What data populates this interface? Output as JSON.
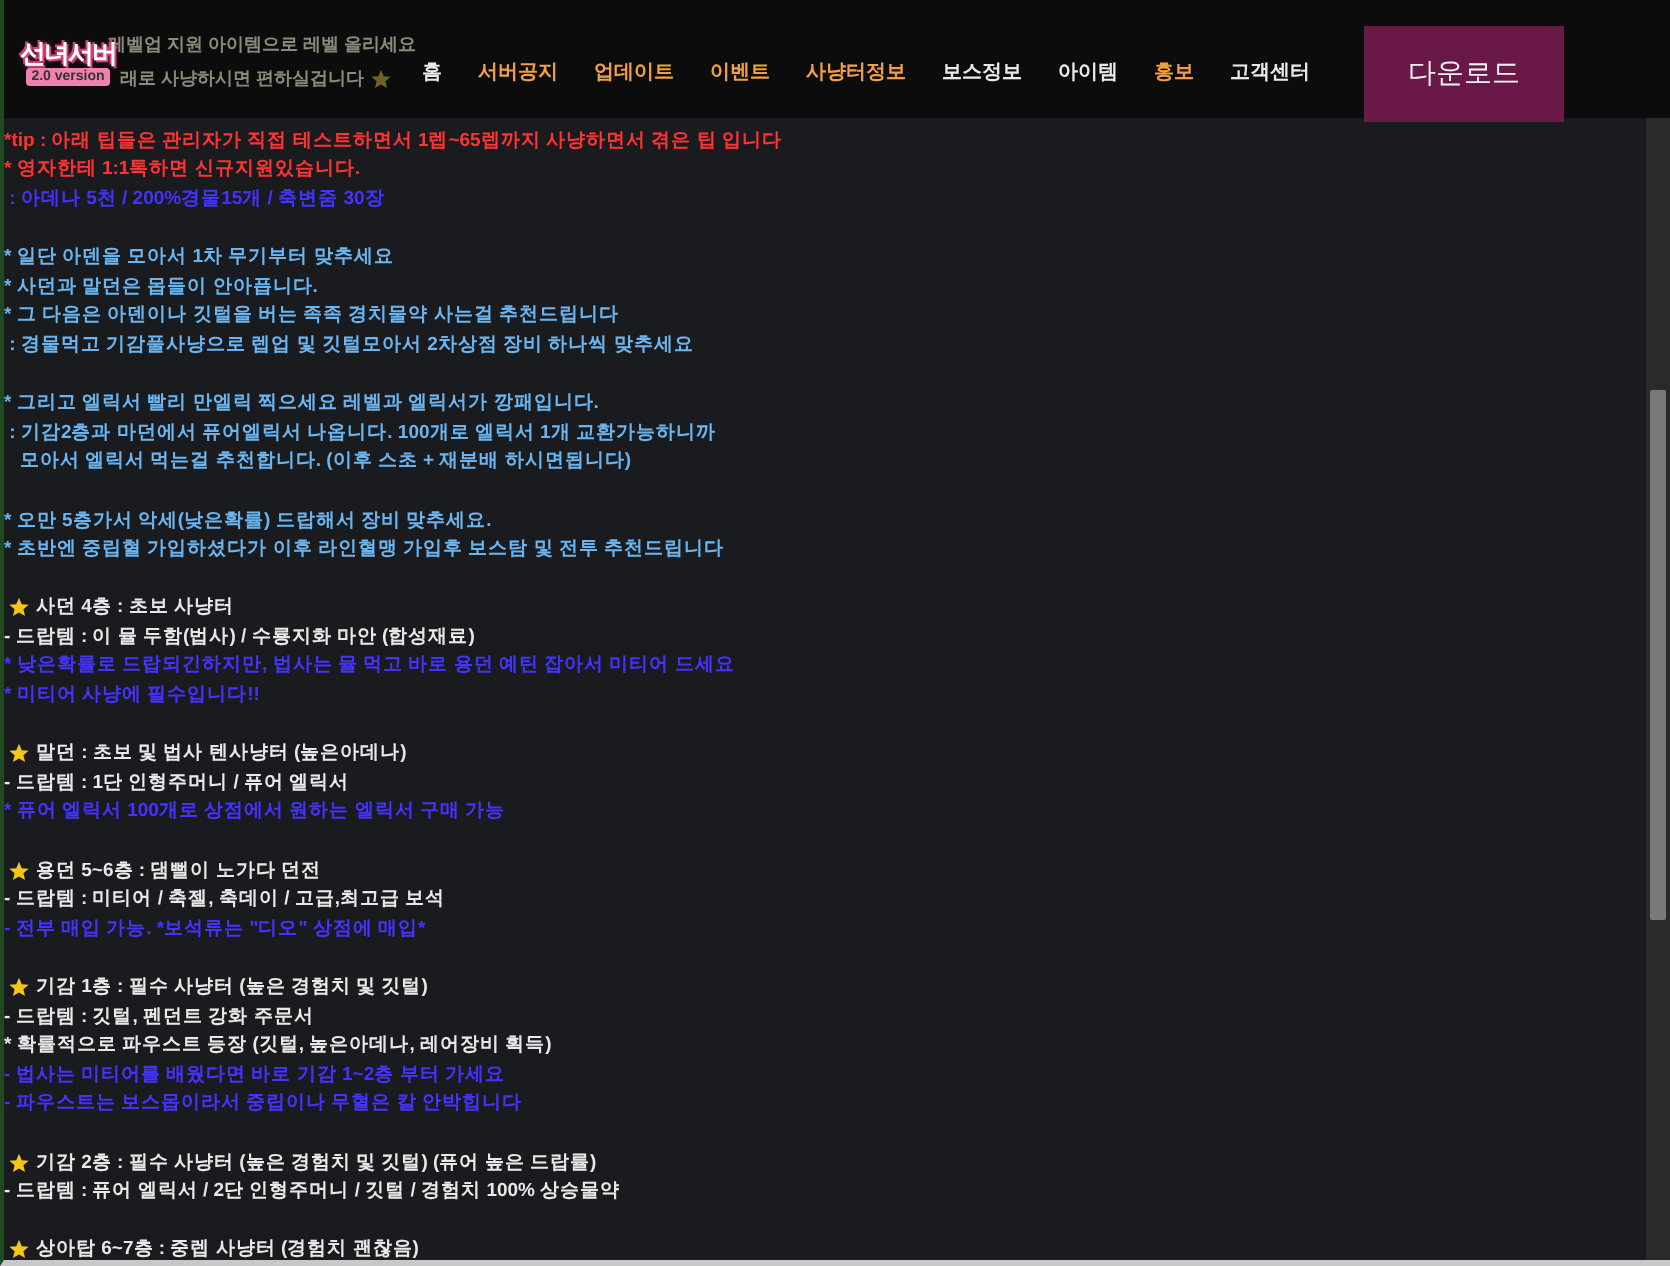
{
  "header": {
    "notice": [
      {
        "text": "레벨업 지원 아이템으로 레벨 올리세요"
      },
      {
        "text": "래로 사냥하시면 편하실겁니다"
      }
    ],
    "logo": {
      "title": "선녀서버",
      "subtitle": "2.0 version"
    },
    "nav": [
      {
        "label": "홈",
        "color": "#e8e8e8"
      },
      {
        "label": "서버공지",
        "color": "#f0a040"
      },
      {
        "label": "업데이트",
        "color": "#f0a040"
      },
      {
        "label": "이벤트",
        "color": "#f0a040"
      },
      {
        "label": "사냥터정보",
        "color": "#f0a040"
      },
      {
        "label": "보스정보",
        "color": "#e8e8e8"
      },
      {
        "label": "아이템",
        "color": "#e8e8e8"
      },
      {
        "label": "홍보",
        "color": "#f0a040"
      },
      {
        "label": "고객센터",
        "color": "#e8e8e8"
      }
    ],
    "download": "다운로드"
  },
  "sections": [
    {
      "lines": [
        {
          "kind": "text",
          "color": "#ff3333",
          "text": "*tip : 아래 팁들은 관리자가 직접 테스트하면서 1렙~65렙까지 사냥하면서 겪은 팁 입니다"
        },
        {
          "kind": "text",
          "color": "#ff3333",
          "text": "* 영자한테 1:1톡하면 신규지원있습니다."
        },
        {
          "kind": "text",
          "color": "#4433ff",
          "text": " : 아데나 5천 / 200%경물15개 / 축변줌 30장"
        }
      ]
    },
    {
      "lines": [
        {
          "kind": "text",
          "color": "#6ab4f0",
          "text": "* 일단 아덴을 모아서 1차 무기부터 맞추세요"
        },
        {
          "kind": "text",
          "color": "#6ab4f0",
          "text": "* 사던과 말던은 몹들이 안아픕니다."
        },
        {
          "kind": "text",
          "color": "#6ab4f0",
          "text": "* 그 다음은 아덴이나 깃털을 버는 족족 경치물약 사는걸 추천드립니다"
        },
        {
          "kind": "text",
          "color": "#6ab4f0",
          "text": " : 경물먹고 기감풀사냥으로 렙업 및 깃털모아서 2차상점 장비 하나씩 맞추세요"
        }
      ]
    },
    {
      "lines": [
        {
          "kind": "text",
          "color": "#6ab4f0",
          "text": "* 그리고 엘릭서 빨리 만엘릭 찍으세요 레벨과 엘릭서가 깡패입니다."
        },
        {
          "kind": "text",
          "color": "#6ab4f0",
          "text": " : 기감2층과 마던에서 퓨어엘릭서 나옵니다. 100개로 엘릭서 1개 교환가능하니까"
        },
        {
          "kind": "text",
          "color": "#6ab4f0",
          "text": "   모아서 엘릭서 먹는걸 추천합니다. (이후 스초 + 재분배 하시면됩니다)"
        }
      ]
    },
    {
      "lines": [
        {
          "kind": "text",
          "color": "#6ab4f0",
          "text": "* 오만 5층가서 악세(낮은확률) 드랍해서 장비 맞추세요."
        },
        {
          "kind": "text",
          "color": "#6ab4f0",
          "text": "* 초반엔 중립혈 가입하셨다가 이후 라인혈맹 가입후 보스탐 및 전투 추천드립니다"
        }
      ]
    },
    {
      "lines": [
        {
          "kind": "heading",
          "color": "#e8e8e8",
          "text": "사던 4층 : 초보 사냥터"
        },
        {
          "kind": "text",
          "color": "#e8e8e8",
          "text": "- 드랍템 : 이 뮬 두함(법사) / 수룡지화 마안 (합성재료)"
        },
        {
          "kind": "text",
          "color": "#4433ff",
          "text": "* 낮은확률로 드랍되긴하지만, 법사는 뮬 먹고 바로 용던 예틴 잡아서 미티어 드세요"
        },
        {
          "kind": "text",
          "color": "#4433ff",
          "text": "* 미티어 사냥에 필수입니다!!"
        }
      ]
    },
    {
      "lines": [
        {
          "kind": "heading",
          "color": "#e8e8e8",
          "text": "말던 : 초보 및 법사 텐사냥터 (높은아데나)"
        },
        {
          "kind": "text",
          "color": "#e8e8e8",
          "text": "- 드랍템 : 1단 인형주머니 / 퓨어 엘릭서"
        },
        {
          "kind": "text",
          "color": "#4433ff",
          "text": "* 퓨어 엘릭서 100개로 상점에서 원하는 엘릭서 구매 가능"
        }
      ]
    },
    {
      "lines": [
        {
          "kind": "heading",
          "color": "#e8e8e8",
          "text": "용던 5~6층 : 댐뻘이 노가다 던전"
        },
        {
          "kind": "text",
          "color": "#e8e8e8",
          "text": "- 드랍템 : 미티어 / 축젤, 축데이 / 고급,최고급 보석"
        },
        {
          "kind": "text",
          "color": "#4433ff",
          "text": "- 전부 매입 가능. *보석류는 \"디오\" 상점에 매입*"
        }
      ]
    },
    {
      "lines": [
        {
          "kind": "heading",
          "color": "#e8e8e8",
          "text": "기감 1층 : 필수 사냥터 (높은 경험치 및 깃털)"
        },
        {
          "kind": "text",
          "color": "#e8e8e8",
          "text": "- 드랍템 : 깃털, 펜던트 강화 주문서"
        },
        {
          "kind": "text",
          "color": "#e8e8e8",
          "text": "* 확률적으로 파우스트 등장 (깃털, 높은아데나, 레어장비 획득)"
        },
        {
          "kind": "text",
          "color": "#4433ff",
          "text": "- 법사는 미티어를 배웠다면 바로 기감 1~2층 부터 가세요"
        },
        {
          "kind": "text",
          "color": "#4433ff",
          "text": "- 파우스트는 보스몹이라서 중립이나 무혈은 칼 안박힙니다"
        }
      ]
    },
    {
      "lines": [
        {
          "kind": "heading",
          "color": "#e8e8e8",
          "text": "기감 2층 : 필수 사냥터 (높은 경험치 및 깃털) (퓨어 높은 드랍률)"
        },
        {
          "kind": "text",
          "color": "#e8e8e8",
          "text": "- 드랍템 : 퓨어 엘릭서 / 2단 인형주머니 / 깃털 / 경험치 100% 상승물약"
        }
      ]
    },
    {
      "lines": [
        {
          "kind": "heading",
          "color": "#e8e8e8",
          "text": "상아탑 6~7층 : 중렙 사냥터 (경험치 괜찮음)"
        }
      ]
    }
  ]
}
